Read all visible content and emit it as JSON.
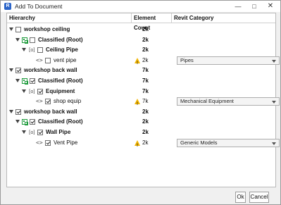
{
  "window": {
    "title": "Add To Document",
    "app_icon": "revit-icon"
  },
  "table": {
    "columns": [
      "Hierarchy",
      "Element Count",
      "Revit Category"
    ],
    "rows": [
      {
        "level": 0,
        "kind": "group",
        "label": "workshop ceiling",
        "checked": false,
        "count": "2k"
      },
      {
        "level": 1,
        "kind": "classified",
        "label": "Classified (Root)",
        "checked": false,
        "count": "2k"
      },
      {
        "level": 2,
        "kind": "category",
        "label": "Ceiling Pipe",
        "checked": false,
        "count": "2k"
      },
      {
        "level": 3,
        "kind": "element",
        "label": "vent pipe",
        "checked": false,
        "count": "2k",
        "warning": true,
        "category": "Pipes"
      },
      {
        "level": 0,
        "kind": "group",
        "label": "workshop back wall",
        "checked": true,
        "count": "7k"
      },
      {
        "level": 1,
        "kind": "classified",
        "label": "Classified (Root)",
        "checked": true,
        "count": "7k"
      },
      {
        "level": 2,
        "kind": "category",
        "label": "Equipment",
        "checked": true,
        "count": "7k"
      },
      {
        "level": 3,
        "kind": "element",
        "label": "shop equip",
        "checked": true,
        "count": "7k",
        "warning": true,
        "category": "Mechanical Equipment"
      },
      {
        "level": 0,
        "kind": "group",
        "label": "workshop back wall",
        "checked": true,
        "count": "2k"
      },
      {
        "level": 1,
        "kind": "classified",
        "label": "Classified (Root)",
        "checked": true,
        "count": "2k"
      },
      {
        "level": 2,
        "kind": "category",
        "label": "Wall Pipe",
        "checked": true,
        "count": "2k"
      },
      {
        "level": 3,
        "kind": "element",
        "label": "Vent Pipe",
        "checked": true,
        "count": "2k",
        "warning": true,
        "category": "Generic Models"
      }
    ]
  },
  "buttons": {
    "ok": "Ok",
    "cancel": "Cancel"
  }
}
